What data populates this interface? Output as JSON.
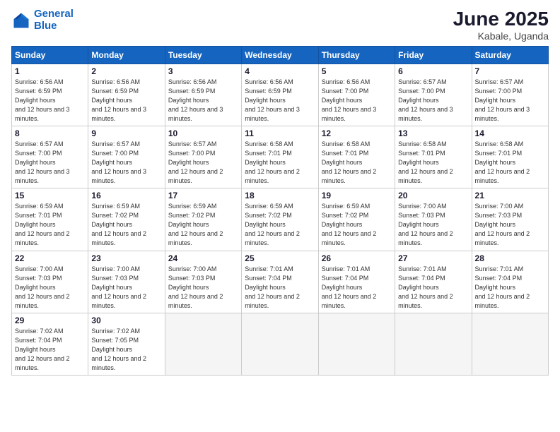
{
  "logo": {
    "line1": "General",
    "line2": "Blue"
  },
  "title": "June 2025",
  "location": "Kabale, Uganda",
  "days_of_week": [
    "Sunday",
    "Monday",
    "Tuesday",
    "Wednesday",
    "Thursday",
    "Friday",
    "Saturday"
  ],
  "weeks": [
    [
      {
        "day": 1,
        "sunrise": "6:56 AM",
        "sunset": "6:59 PM",
        "daylight": "12 hours and 3 minutes."
      },
      {
        "day": 2,
        "sunrise": "6:56 AM",
        "sunset": "6:59 PM",
        "daylight": "12 hours and 3 minutes."
      },
      {
        "day": 3,
        "sunrise": "6:56 AM",
        "sunset": "6:59 PM",
        "daylight": "12 hours and 3 minutes."
      },
      {
        "day": 4,
        "sunrise": "6:56 AM",
        "sunset": "6:59 PM",
        "daylight": "12 hours and 3 minutes."
      },
      {
        "day": 5,
        "sunrise": "6:56 AM",
        "sunset": "7:00 PM",
        "daylight": "12 hours and 3 minutes."
      },
      {
        "day": 6,
        "sunrise": "6:57 AM",
        "sunset": "7:00 PM",
        "daylight": "12 hours and 3 minutes."
      },
      {
        "day": 7,
        "sunrise": "6:57 AM",
        "sunset": "7:00 PM",
        "daylight": "12 hours and 3 minutes."
      }
    ],
    [
      {
        "day": 8,
        "sunrise": "6:57 AM",
        "sunset": "7:00 PM",
        "daylight": "12 hours and 3 minutes."
      },
      {
        "day": 9,
        "sunrise": "6:57 AM",
        "sunset": "7:00 PM",
        "daylight": "12 hours and 3 minutes."
      },
      {
        "day": 10,
        "sunrise": "6:57 AM",
        "sunset": "7:00 PM",
        "daylight": "12 hours and 2 minutes."
      },
      {
        "day": 11,
        "sunrise": "6:58 AM",
        "sunset": "7:01 PM",
        "daylight": "12 hours and 2 minutes."
      },
      {
        "day": 12,
        "sunrise": "6:58 AM",
        "sunset": "7:01 PM",
        "daylight": "12 hours and 2 minutes."
      },
      {
        "day": 13,
        "sunrise": "6:58 AM",
        "sunset": "7:01 PM",
        "daylight": "12 hours and 2 minutes."
      },
      {
        "day": 14,
        "sunrise": "6:58 AM",
        "sunset": "7:01 PM",
        "daylight": "12 hours and 2 minutes."
      }
    ],
    [
      {
        "day": 15,
        "sunrise": "6:59 AM",
        "sunset": "7:01 PM",
        "daylight": "12 hours and 2 minutes."
      },
      {
        "day": 16,
        "sunrise": "6:59 AM",
        "sunset": "7:02 PM",
        "daylight": "12 hours and 2 minutes."
      },
      {
        "day": 17,
        "sunrise": "6:59 AM",
        "sunset": "7:02 PM",
        "daylight": "12 hours and 2 minutes."
      },
      {
        "day": 18,
        "sunrise": "6:59 AM",
        "sunset": "7:02 PM",
        "daylight": "12 hours and 2 minutes."
      },
      {
        "day": 19,
        "sunrise": "6:59 AM",
        "sunset": "7:02 PM",
        "daylight": "12 hours and 2 minutes."
      },
      {
        "day": 20,
        "sunrise": "7:00 AM",
        "sunset": "7:03 PM",
        "daylight": "12 hours and 2 minutes."
      },
      {
        "day": 21,
        "sunrise": "7:00 AM",
        "sunset": "7:03 PM",
        "daylight": "12 hours and 2 minutes."
      }
    ],
    [
      {
        "day": 22,
        "sunrise": "7:00 AM",
        "sunset": "7:03 PM",
        "daylight": "12 hours and 2 minutes."
      },
      {
        "day": 23,
        "sunrise": "7:00 AM",
        "sunset": "7:03 PM",
        "daylight": "12 hours and 2 minutes."
      },
      {
        "day": 24,
        "sunrise": "7:00 AM",
        "sunset": "7:03 PM",
        "daylight": "12 hours and 2 minutes."
      },
      {
        "day": 25,
        "sunrise": "7:01 AM",
        "sunset": "7:04 PM",
        "daylight": "12 hours and 2 minutes."
      },
      {
        "day": 26,
        "sunrise": "7:01 AM",
        "sunset": "7:04 PM",
        "daylight": "12 hours and 2 minutes."
      },
      {
        "day": 27,
        "sunrise": "7:01 AM",
        "sunset": "7:04 PM",
        "daylight": "12 hours and 2 minutes."
      },
      {
        "day": 28,
        "sunrise": "7:01 AM",
        "sunset": "7:04 PM",
        "daylight": "12 hours and 2 minutes."
      }
    ],
    [
      {
        "day": 29,
        "sunrise": "7:02 AM",
        "sunset": "7:04 PM",
        "daylight": "12 hours and 2 minutes."
      },
      {
        "day": 30,
        "sunrise": "7:02 AM",
        "sunset": "7:05 PM",
        "daylight": "12 hours and 2 minutes."
      },
      null,
      null,
      null,
      null,
      null
    ]
  ]
}
